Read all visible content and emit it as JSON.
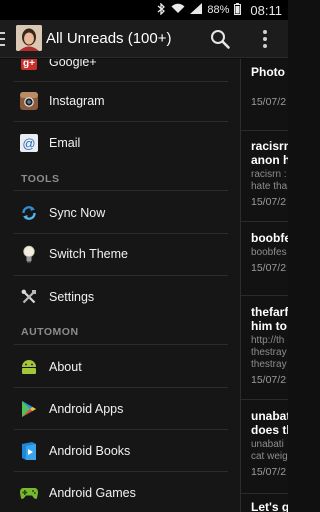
{
  "status_bar": {
    "battery": "88%",
    "time": "08:11"
  },
  "action_bar": {
    "title": "All Unreads (100+)"
  },
  "drawer": {
    "cut_item": {
      "label": "Google+"
    },
    "top_items": [
      {
        "label": "Instagram",
        "icon": "instagram-icon"
      },
      {
        "label": "Email",
        "icon": "email-icon"
      }
    ],
    "tools_header": "TOOLS",
    "tools_items": [
      {
        "label": "Sync Now",
        "icon": "sync-icon"
      },
      {
        "label": "Switch Theme",
        "icon": "lightbulb-icon"
      },
      {
        "label": "Settings",
        "icon": "tools-icon"
      }
    ],
    "automon_header": "AUTOMON",
    "automon_items": [
      {
        "label": "About",
        "icon": "android-icon"
      },
      {
        "label": "Android Apps",
        "icon": "play-store-icon"
      },
      {
        "label": "Android Books",
        "icon": "play-books-icon"
      },
      {
        "label": "Android Games",
        "icon": "gamepad-icon"
      }
    ]
  },
  "articles": [
    {
      "title1": "Photo",
      "title2": "",
      "snippet1": "",
      "snippet2": "",
      "date": "15/07/2"
    },
    {
      "title1": "racisrn",
      "title2": "anon h",
      "snippet1": "racisrn :",
      "snippet2": "hate tha",
      "date": "15/07/2"
    },
    {
      "title1": "boobfe",
      "title2": "",
      "snippet1": "boobfes",
      "snippet2": "",
      "date": "15/07/2"
    },
    {
      "title1": "thefarf",
      "title2": "him to",
      "snippet1": "http://th",
      "snippet2": "thestray",
      "snippet3": "thestray",
      "date": "15/07/2"
    },
    {
      "title1": "unabat",
      "title2": "does th",
      "snippet1": "unabati",
      "snippet2": "cat weig",
      "date": "15/07/2"
    },
    {
      "title1": "Let's go",
      "title2": "",
      "snippet1": "",
      "snippet2": "",
      "date": ""
    }
  ],
  "colors": {
    "accent_red": "#d93025",
    "android_green": "#a4c639",
    "sync_blue": "#2f8fd8"
  }
}
